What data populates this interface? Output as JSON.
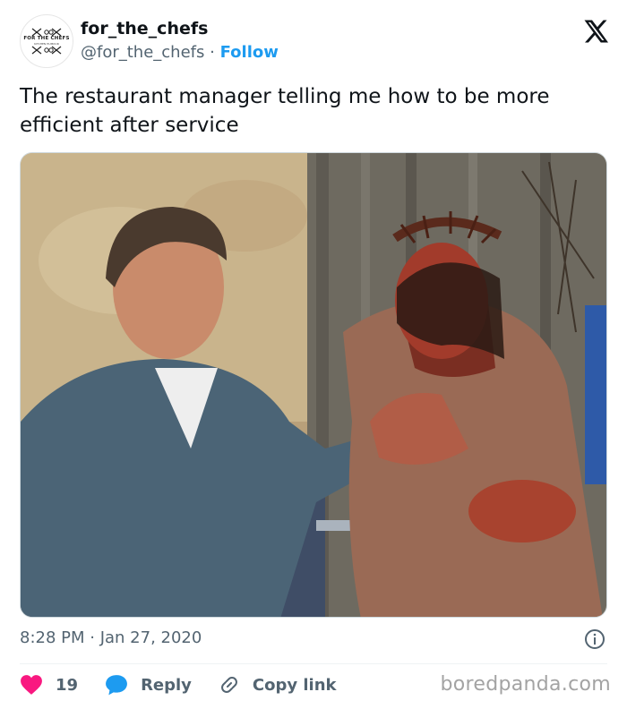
{
  "author": {
    "display_name": "for_the_chefs",
    "handle": "@for_the_chefs",
    "separator": "·",
    "follow_label": "Follow",
    "avatar_text": "FOR THE CHEFS",
    "avatar_subtext": "KITCHEN HUMOUR"
  },
  "tweet": {
    "text": "The restaurant manager telling me how to be more efficient after service",
    "timestamp": "8:28 PM · Jan 27, 2020"
  },
  "actions": {
    "like_count": "19",
    "reply_label": "Reply",
    "copy_link_label": "Copy link"
  },
  "watermark": "boredpanda.com",
  "colors": {
    "accent": "#1d9bf0",
    "like": "#f91880",
    "text": "#0f1419",
    "secondary": "#536471"
  },
  "icons": [
    "x-logo-icon",
    "info-icon",
    "heart-icon",
    "reply-bubble-icon",
    "link-icon"
  ]
}
